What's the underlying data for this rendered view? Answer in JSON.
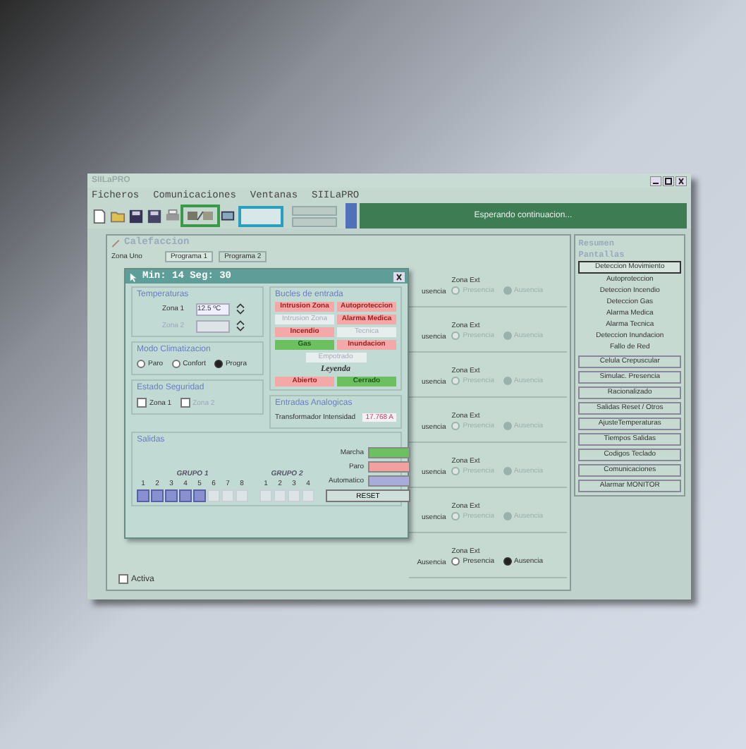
{
  "window": {
    "title": "SIILaPRO"
  },
  "menu": [
    "Ficheros",
    "Comunicaciones",
    "Ventanas",
    "SIILaPRO"
  ],
  "status": "Esperando continuacion...",
  "child_window": {
    "title": "Calefaccion",
    "zone_label": "Zona Uno",
    "tabs": [
      {
        "label": "Programa 1",
        "selected": true
      },
      {
        "label": "Programa 2",
        "selected": false
      }
    ],
    "zone_rows": [
      {
        "cut_label": "usencia",
        "label": "Zona Ext",
        "presence": "Presencia",
        "absence": "Ausencia",
        "absent": true,
        "disabled": true
      },
      {
        "cut_label": "usencia",
        "label": "Zona Ext",
        "presence": "Presencia",
        "absence": "Ausencia",
        "absent": true,
        "disabled": true
      },
      {
        "cut_label": "usencia",
        "label": "Zona Ext",
        "presence": "Presencia",
        "absence": "Ausencia",
        "absent": true,
        "disabled": true
      },
      {
        "cut_label": "usencia",
        "label": "Zona Ext",
        "presence": "Presencia",
        "absence": "Ausencia",
        "absent": true,
        "disabled": true
      },
      {
        "cut_label": "usencia",
        "label": "Zona Ext",
        "presence": "Presencia",
        "absence": "Ausencia",
        "absent": true,
        "disabled": true
      },
      {
        "cut_label": "usencia",
        "label": "Zona Ext",
        "presence": "Presencia",
        "absence": "Ausencia",
        "absent": true,
        "disabled": true
      },
      {
        "cut_label": "Ausencia",
        "label": "Zona Ext",
        "presence": "Presencia",
        "absence": "Ausencia",
        "absent": true,
        "disabled": false
      }
    ],
    "activa": {
      "label": "Activa",
      "checked": false
    }
  },
  "side_panel": {
    "title": "Resumen",
    "subtitle": "Pantallas",
    "items": [
      {
        "label": "Deteccion Movimiento",
        "kind": "list",
        "selected": true
      },
      {
        "label": "Autoproteccion",
        "kind": "list",
        "selected": false
      },
      {
        "label": "Deteccion Incendio",
        "kind": "list",
        "selected": false
      },
      {
        "label": "Deteccion Gas",
        "kind": "list",
        "selected": false
      },
      {
        "label": "Alarma Medica",
        "kind": "list",
        "selected": false
      },
      {
        "label": "Alarma Tecnica",
        "kind": "list",
        "selected": false
      },
      {
        "label": "Deteccion Inundacion",
        "kind": "list",
        "selected": false
      },
      {
        "label": "Fallo de Red",
        "kind": "list",
        "selected": false
      },
      {
        "label": "Celula Crepuscular",
        "kind": "button",
        "selected": false
      },
      {
        "label": "Simulac. Presencia",
        "kind": "button",
        "selected": false
      },
      {
        "label": "Racionalizado",
        "kind": "button",
        "selected": false
      },
      {
        "label": "Salidas Reset / Otros",
        "kind": "button",
        "selected": false
      },
      {
        "label": "AjusteTemperaturas",
        "kind": "button",
        "selected": false
      },
      {
        "label": "Tiempos Salidas",
        "kind": "button",
        "selected": false
      },
      {
        "label": "Codigos Teclado",
        "kind": "button",
        "selected": false
      },
      {
        "label": "Comunicaciones",
        "kind": "button",
        "selected": false
      },
      {
        "label": "Alarmar MONITOR",
        "kind": "button",
        "selected": false
      }
    ]
  },
  "dialog": {
    "title": "Min: 14 Seg: 30",
    "temperatures": {
      "title": "Temperaturas",
      "zones": [
        {
          "label": "Zona 1",
          "value": "12.5 ºC",
          "disabled": false
        },
        {
          "label": "Zona 2",
          "disabled": true
        }
      ]
    },
    "climate": {
      "title": "Modo Climatizacion",
      "options": [
        {
          "label": "Paro",
          "selected": false
        },
        {
          "label": "Confort",
          "selected": false
        },
        {
          "label": "Progra",
          "selected": true
        }
      ]
    },
    "security": {
      "title": "Estado Seguridad",
      "zones": [
        {
          "label": "Zona 1",
          "checked": false,
          "disabled": false
        },
        {
          "label": "Zona 2",
          "checked": false,
          "disabled": true
        }
      ]
    },
    "loops": {
      "title": "Bucles de entrada",
      "items": [
        {
          "label": "Intrusion Zona",
          "open": true,
          "disabled": false
        },
        {
          "label": "Autoproteccion",
          "open": true,
          "disabled": false
        },
        {
          "label": "Intrusion Zona",
          "disabled": true
        },
        {
          "label": "Alarma Medica",
          "open": true,
          "disabled": false
        },
        {
          "label": "Incendio",
          "open": true,
          "disabled": false
        },
        {
          "label": "Tecnica",
          "disabled": true
        },
        {
          "label": "Gas",
          "open": false,
          "disabled": false
        },
        {
          "label": "Inundacion",
          "open": true,
          "disabled": false
        },
        {
          "label": "Empotrado",
          "disabled": true
        }
      ],
      "legend_title": "Leyenda",
      "legend": [
        {
          "label": "Abierto",
          "open": true
        },
        {
          "label": "Cerrado",
          "open": false
        }
      ]
    },
    "analog": {
      "title": "Entradas Analogicas",
      "label": "Transformador Intensidad",
      "value": "17.768 A"
    },
    "outputs": {
      "title": "Salidas",
      "groups": [
        {
          "title": "GRUPO 1",
          "channels": [
            {
              "label": "1",
              "on": true
            },
            {
              "label": "2",
              "on": true
            },
            {
              "label": "3",
              "on": true
            },
            {
              "label": "4",
              "on": true
            },
            {
              "label": "5",
              "on": true
            },
            {
              "label": "6",
              "on": false
            },
            {
              "label": "7",
              "on": false
            },
            {
              "label": "8",
              "on": false
            }
          ]
        },
        {
          "title": "GRUPO 2",
          "channels": [
            {
              "label": "1",
              "on": false
            },
            {
              "label": "2",
              "on": false
            },
            {
              "label": "3",
              "on": false
            },
            {
              "label": "4",
              "on": false
            }
          ]
        }
      ],
      "legend": [
        {
          "label": "Marcha",
          "color": "#6cc060"
        },
        {
          "label": "Paro",
          "color": "#f2a0a0"
        },
        {
          "label": "Automatico",
          "color": "#a8acd8"
        }
      ],
      "reset": "RESET"
    }
  }
}
